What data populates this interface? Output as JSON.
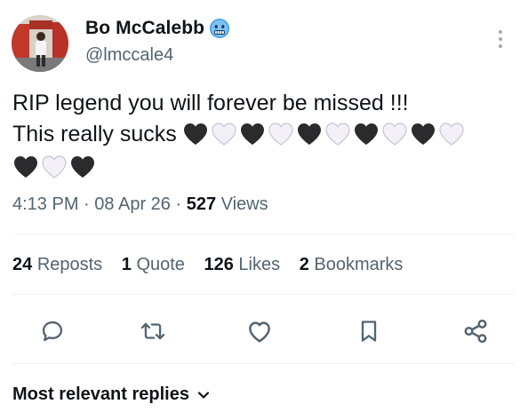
{
  "author": {
    "display_name": "Bo McCalebb",
    "handle": "@lmccale4",
    "avatar_icon": "profile-photo",
    "badge_icon": "cold-face-emoji"
  },
  "tweet": {
    "line1": "RIP legend you will forever be missed !!!",
    "line2": "This really sucks",
    "hearts_line2": [
      "black",
      "white",
      "black",
      "white",
      "black",
      "white",
      "black",
      "white",
      "black",
      "white"
    ],
    "hearts_line3": [
      "black",
      "white",
      "black"
    ]
  },
  "meta": {
    "time": "4:13 PM",
    "date": "08 Apr 26",
    "views_count": "527",
    "views_label": "Views",
    "separator": "·"
  },
  "stats": {
    "reposts_count": "24",
    "reposts_label": "Reposts",
    "quotes_count": "1",
    "quotes_label": "Quote",
    "likes_count": "126",
    "likes_label": "Likes",
    "bookmarks_count": "2",
    "bookmarks_label": "Bookmarks"
  },
  "actions": {
    "icons": [
      "reply-icon",
      "repost-icon",
      "like-icon",
      "bookmark-icon",
      "share-icon"
    ]
  },
  "replies": {
    "sort_label": "Most relevant replies"
  },
  "colors": {
    "text": "#0f1419",
    "secondary": "#536471",
    "divider": "#eff3f4"
  }
}
